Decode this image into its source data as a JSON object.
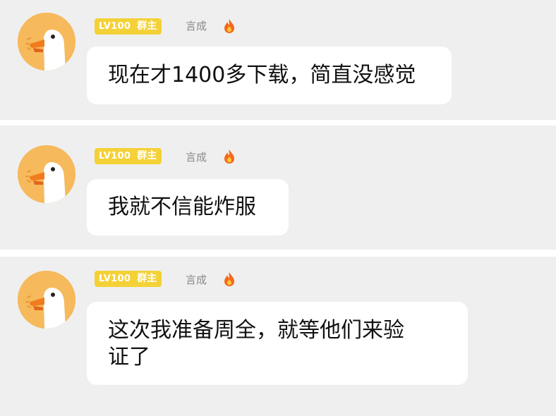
{
  "colors": {
    "panel_bg": "#efefef",
    "bubble_bg": "#ffffff",
    "badge_yellow": "#f4d136",
    "avatar_orange": "#f6b95b",
    "name_gray": "#8a8a8a"
  },
  "messages": [
    {
      "badge_level": "LV100",
      "badge_role": "群主",
      "username": "言成",
      "icon": "flame-icon",
      "text": "现在才1400多下载，简直没感觉"
    },
    {
      "badge_level": "LV100",
      "badge_role": "群主",
      "username": "言成",
      "icon": "flame-icon",
      "text": "我就不信能炸服"
    },
    {
      "badge_level": "LV100",
      "badge_role": "群主",
      "username": "言成",
      "icon": "flame-icon",
      "text_line1": "这次我准备周全，就等他们来验",
      "text_line2": "证了"
    }
  ]
}
